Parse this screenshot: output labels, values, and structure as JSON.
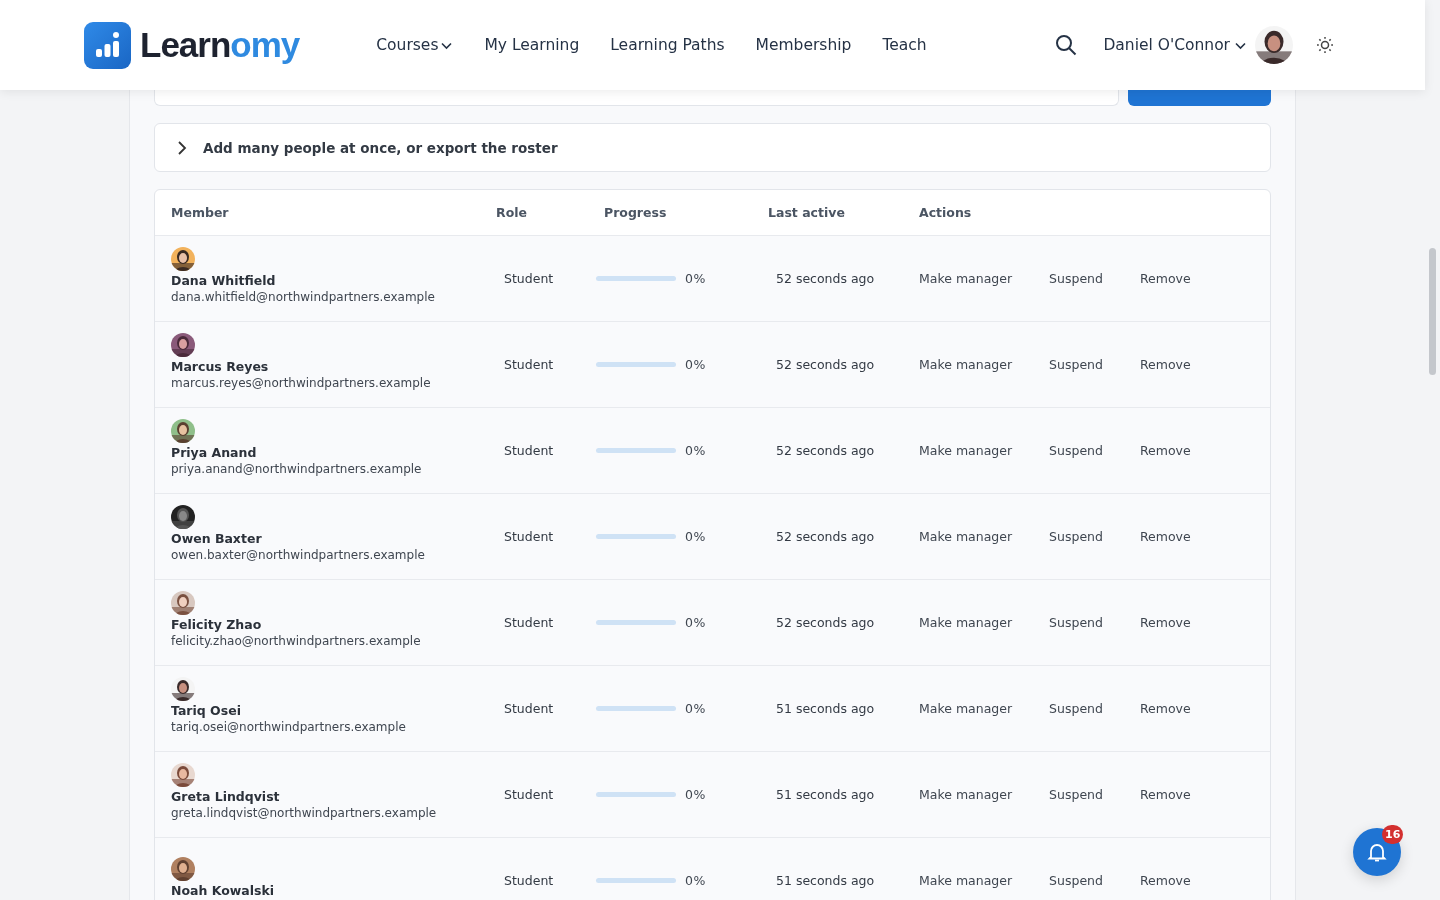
{
  "header": {
    "logo": {
      "part_1": "Learn",
      "part_2": "omy"
    },
    "nav": [
      {
        "label": "Courses",
        "dropdown": true
      },
      {
        "label": "My Learning",
        "dropdown": false
      },
      {
        "label": "Learning Paths",
        "dropdown": false
      },
      {
        "label": "Membership",
        "dropdown": false
      },
      {
        "label": "Teach",
        "dropdown": false
      }
    ],
    "user": {
      "name": "Daniel O'Connor"
    }
  },
  "bulk_section": {
    "label": "Add many people at once, or export the roster",
    "expanded": false
  },
  "table": {
    "columns": [
      "Member",
      "Role",
      "Progress",
      "Last active",
      "Actions"
    ],
    "rows": [
      {
        "name": "Dana Whitfield",
        "email": "dana.whitfield@northwindpartners.example",
        "role": "Student",
        "level": 0,
        "progress": "0%",
        "last_active": "52 seconds ago",
        "actions": [
          "Make manager",
          "Suspend",
          "Remove"
        ]
      },
      {
        "name": "Marcus Reyes",
        "email": "marcus.reyes@northwindpartners.example",
        "role": "Student",
        "level": 0,
        "progress": "0%",
        "last_active": "52 seconds ago",
        "actions": [
          "Make manager",
          "Suspend",
          "Remove"
        ]
      },
      {
        "name": "Priya Anand",
        "email": "priya.anand@northwindpartners.example",
        "role": "Student",
        "level": 0,
        "progress": "0%",
        "last_active": "52 seconds ago",
        "actions": [
          "Make manager",
          "Suspend",
          "Remove"
        ]
      },
      {
        "name": "Owen Baxter",
        "email": "owen.baxter@northwindpartners.example",
        "role": "Student",
        "level": 0,
        "progress": "0%",
        "last_active": "52 seconds ago",
        "actions": [
          "Make manager",
          "Suspend",
          "Remove"
        ]
      },
      {
        "name": "Felicity Zhao",
        "email": "felicity.zhao@northwindpartners.example",
        "role": "Student",
        "level": 0,
        "progress": "0%",
        "last_active": "52 seconds ago",
        "actions": [
          "Make manager",
          "Suspend",
          "Remove"
        ]
      },
      {
        "name": "Tariq Osei",
        "email": "tariq.osei@northwindpartners.example",
        "role": "Student",
        "level": 0,
        "progress": "0%",
        "last_active": "51 seconds ago",
        "actions": [
          "Make manager",
          "Suspend",
          "Remove"
        ]
      },
      {
        "name": "Greta Lindqvist",
        "email": "greta.lindqvist@northwindpartners.example",
        "role": "Student",
        "level": 0,
        "progress": "0%",
        "last_active": "51 seconds ago",
        "actions": [
          "Make manager",
          "Suspend",
          "Remove"
        ]
      },
      {
        "name": "Noah Kowalski",
        "role": "Student",
        "level": 0,
        "progress": "0%",
        "last_active": "51 seconds ago",
        "actions": [
          "Make manager",
          "Suspend",
          "Remove"
        ]
      }
    ]
  },
  "notifications": {
    "count": "16"
  }
}
